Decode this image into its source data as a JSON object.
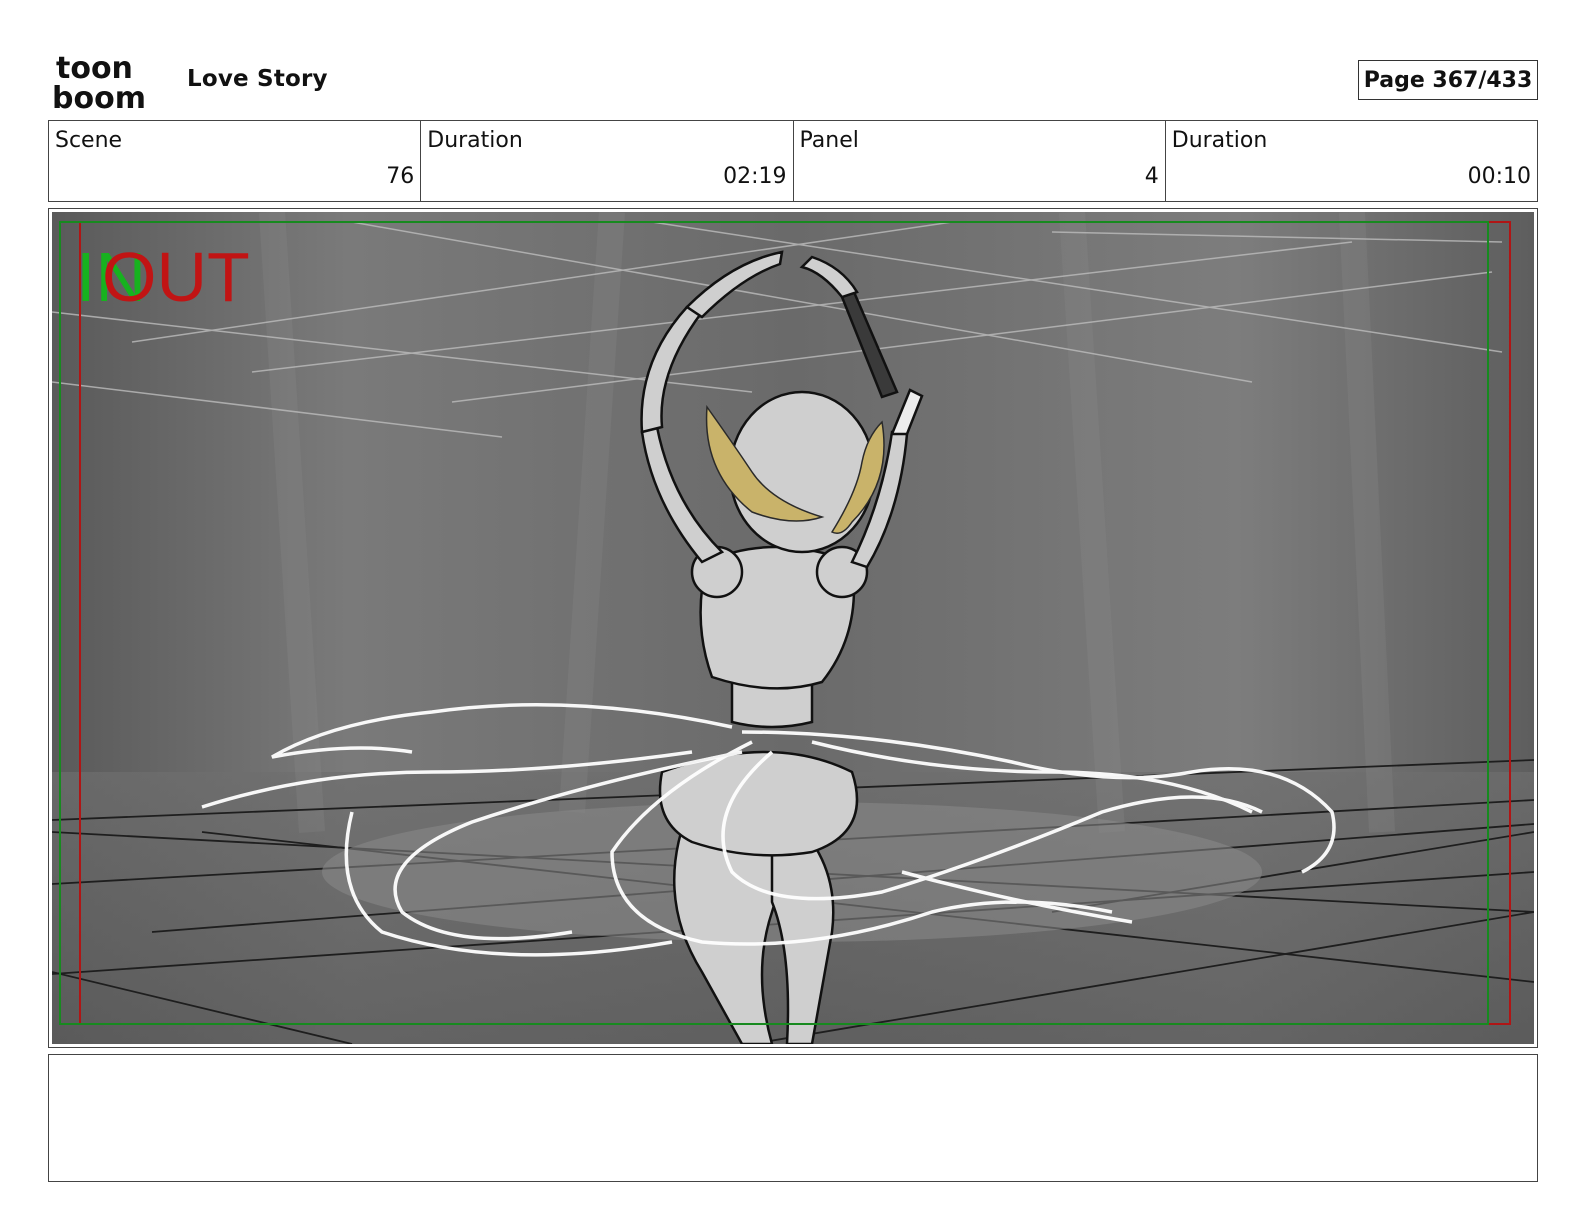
{
  "header": {
    "logo_text_top": "toon",
    "logo_text_bottom": "boom",
    "project_title": "Love Story",
    "page_label": "Page 367/433"
  },
  "info": [
    {
      "label": "Scene",
      "value": "76"
    },
    {
      "label": "Duration",
      "value": "02:19"
    },
    {
      "label": "Panel",
      "value": "4"
    },
    {
      "label": "Duration",
      "value": "00:10"
    }
  ],
  "panel": {
    "in_marker": "IN",
    "out_marker": "OUT"
  },
  "notes": {
    "text": ""
  },
  "colors": {
    "in_green": "#17b21f",
    "out_red": "#c11414",
    "laurel_gold": "#c9b36a",
    "background_gray": "#707070"
  }
}
